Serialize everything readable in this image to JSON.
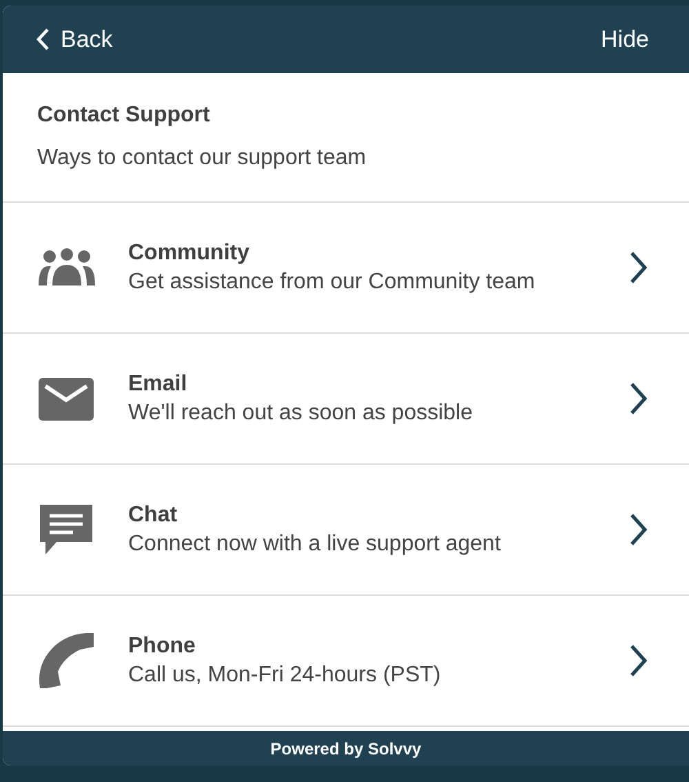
{
  "header": {
    "back": "Back",
    "hide": "Hide"
  },
  "intro": {
    "title": "Contact Support",
    "subtitle": "Ways to contact our support team"
  },
  "options": [
    {
      "kind": "community",
      "title": "Community",
      "description": "Get assistance from our Community team"
    },
    {
      "kind": "email",
      "title": "Email",
      "description": "We'll reach out as soon as possible"
    },
    {
      "kind": "chat",
      "title": "Chat",
      "description": "Connect now with a live support agent"
    },
    {
      "kind": "phone",
      "title": "Phone",
      "description": "Call us, Mon-Fri 24-hours (PST)"
    }
  ],
  "footer": "Powered by Solvvy"
}
